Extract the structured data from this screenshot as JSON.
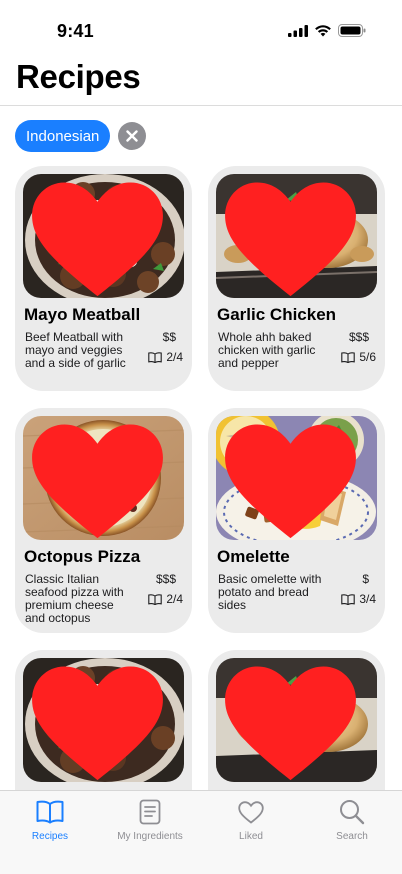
{
  "status_bar": {
    "time": "9:41",
    "icons": [
      "cellular-signal-icon",
      "wifi-icon",
      "battery-icon"
    ]
  },
  "header": {
    "title": "Recipes"
  },
  "filters": {
    "active_chip": "Indonesian",
    "clear_icon": "x-circle-icon"
  },
  "colors": {
    "accent": "#1a7fff",
    "heart": "#ff2020",
    "card_bg": "#ebebeb",
    "tab_inactive": "#8e8e93"
  },
  "recipes": [
    {
      "title": "Mayo Meatball",
      "description": "Beef Meatball with mayo and veggies and a side of garlic",
      "price": "$$",
      "steps": "2/4",
      "liked": true,
      "image": "meatball-photo"
    },
    {
      "title": "Garlic Chicken",
      "description": "Whole ahh baked chicken with garlic and pepper",
      "price": "$$$",
      "steps": "5/6",
      "liked": true,
      "image": "chicken-photo"
    },
    {
      "title": "Octopus Pizza",
      "description": "Classic Italian seafood pizza with premium cheese and octopus",
      "price": "$$$",
      "steps": "2/4",
      "liked": true,
      "image": "pizza-photo"
    },
    {
      "title": "Omelette",
      "description": "Basic omelette with potato and bread sides",
      "price": "$",
      "steps": "3/4",
      "liked": true,
      "image": "omelette-photo"
    },
    {
      "title": "",
      "description": "",
      "price": "",
      "steps": "",
      "liked": true,
      "image": "meatball-photo"
    },
    {
      "title": "",
      "description": "",
      "price": "",
      "steps": "",
      "liked": true,
      "image": "chicken-photo"
    }
  ],
  "tab_bar": {
    "tabs": [
      {
        "label": "Recipes",
        "icon": "book-icon",
        "active": true
      },
      {
        "label": "My Ingredients",
        "icon": "list-icon",
        "active": false
      },
      {
        "label": "Liked",
        "icon": "heart-icon",
        "active": false
      },
      {
        "label": "Search",
        "icon": "magnifier-icon",
        "active": false
      }
    ]
  }
}
